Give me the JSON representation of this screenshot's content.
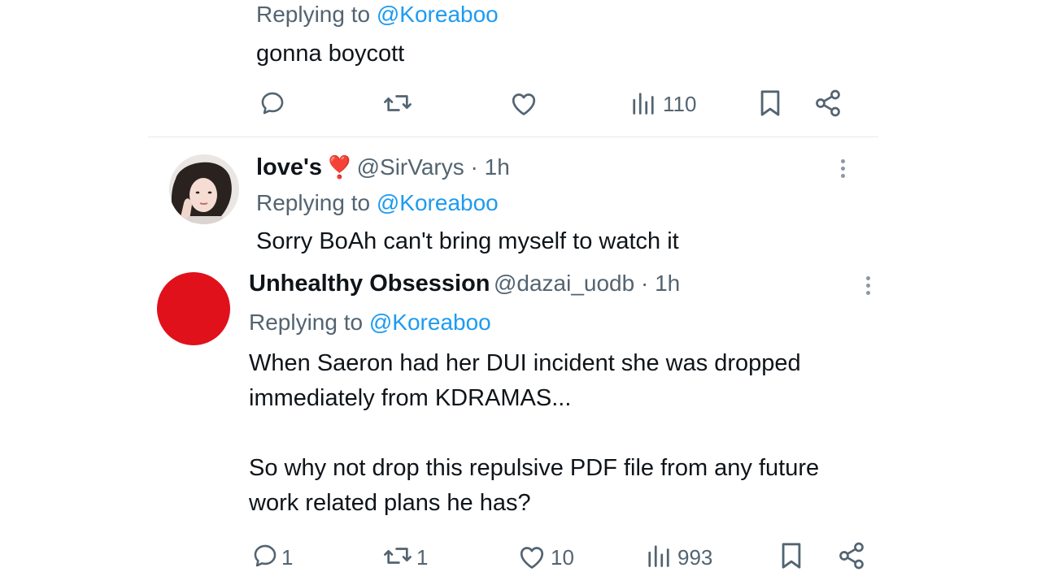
{
  "tweet1": {
    "replying_prefix": "Replying to ",
    "replying_handle": "@Koreaboo",
    "text": "gonna boycott",
    "views": "110"
  },
  "tweet2": {
    "name": "love's",
    "emoji": "❣️",
    "handle": "@SirVarys",
    "time": " · 1h",
    "replying_prefix": "Replying to ",
    "replying_handle": "@Koreaboo",
    "text": "Sorry BoAh can't bring myself to watch it"
  },
  "tweet3": {
    "name": "Unhealthy Obsession",
    "handle": "@dazai_uodb",
    "time": " · 1h",
    "replying_prefix": "Replying to ",
    "replying_handle": "@Koreaboo",
    "text_line1": "When Saeron had her DUI incident she was dropped",
    "text_line2": "immediately from KDRAMAS...",
    "text_line3": "So why not drop this repulsive PDF file from any future",
    "text_line4": "work related plans he has?",
    "replies": "1",
    "reposts": "1",
    "likes": "10",
    "views": "993",
    "avatar_color": "#e0111b"
  },
  "icons": {
    "reply": "reply-icon",
    "repost": "repost-icon",
    "like": "heart-icon",
    "views": "views-icon",
    "bookmark": "bookmark-icon",
    "share": "share-icon",
    "more": "more-icon"
  }
}
